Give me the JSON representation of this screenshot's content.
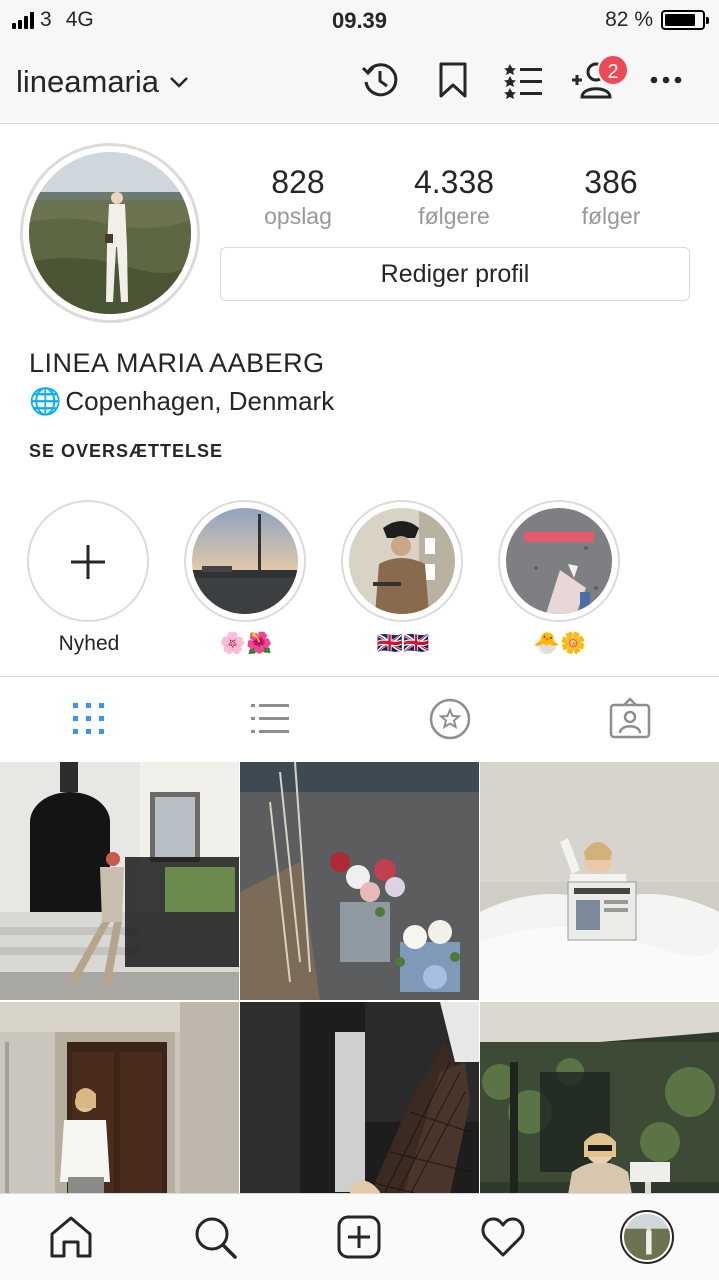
{
  "status_bar": {
    "carrier": "3",
    "network": "4G",
    "time": "09.39",
    "battery": "82 %",
    "battery_level": 0.82
  },
  "header": {
    "username": "lineamaria",
    "notification_count": "2",
    "icons": [
      "chevron-down-icon",
      "archive-clock-icon",
      "bookmark-icon",
      "close-friends-list-icon",
      "discover-people-icon",
      "more-icon"
    ]
  },
  "profile": {
    "stats": [
      {
        "value": "828",
        "label": "opslag"
      },
      {
        "value": "4.338",
        "label": "følgere"
      },
      {
        "value": "386",
        "label": "følger"
      }
    ],
    "edit_button": "Rediger profil",
    "full_name": "LINEA MARIA AABERG",
    "location_emoji": "🌐",
    "location": "Copenhagen, Denmark",
    "translate_link": "SE OVERSÆTTELSE"
  },
  "highlights": [
    {
      "label": "Nyhed",
      "type": "new"
    },
    {
      "label": "🌸🌺",
      "type": "photo"
    },
    {
      "label": "🇬🇧🇬🇧",
      "type": "photo"
    },
    {
      "label": "🐣🌼",
      "type": "photo"
    }
  ],
  "tabs": [
    "grid-icon",
    "list-icon",
    "star-icon",
    "tagged-icon"
  ],
  "colors": {
    "accent_blue": "#3897f0",
    "badge_red": "#ed4956",
    "border": "#dbdbdb"
  },
  "bottom_nav": [
    "home-icon",
    "search-icon",
    "add-post-icon",
    "heart-icon",
    "profile-avatar"
  ]
}
